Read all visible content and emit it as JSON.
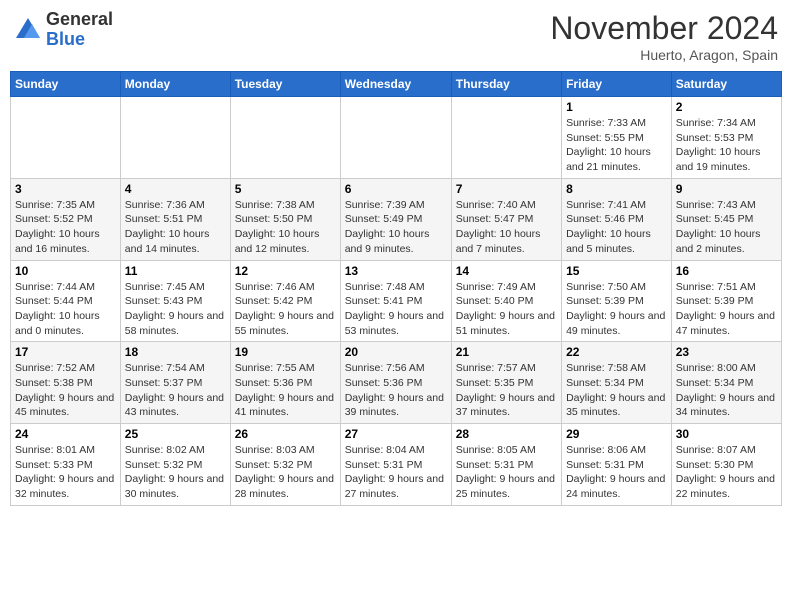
{
  "header": {
    "logo_general": "General",
    "logo_blue": "Blue",
    "month_title": "November 2024",
    "subtitle": "Huerto, Aragon, Spain"
  },
  "days_of_week": [
    "Sunday",
    "Monday",
    "Tuesday",
    "Wednesday",
    "Thursday",
    "Friday",
    "Saturday"
  ],
  "weeks": [
    {
      "days": [
        {
          "num": "",
          "info": ""
        },
        {
          "num": "",
          "info": ""
        },
        {
          "num": "",
          "info": ""
        },
        {
          "num": "",
          "info": ""
        },
        {
          "num": "",
          "info": ""
        },
        {
          "num": "1",
          "info": "Sunrise: 7:33 AM\nSunset: 5:55 PM\nDaylight: 10 hours and 21 minutes."
        },
        {
          "num": "2",
          "info": "Sunrise: 7:34 AM\nSunset: 5:53 PM\nDaylight: 10 hours and 19 minutes."
        }
      ]
    },
    {
      "days": [
        {
          "num": "3",
          "info": "Sunrise: 7:35 AM\nSunset: 5:52 PM\nDaylight: 10 hours and 16 minutes."
        },
        {
          "num": "4",
          "info": "Sunrise: 7:36 AM\nSunset: 5:51 PM\nDaylight: 10 hours and 14 minutes."
        },
        {
          "num": "5",
          "info": "Sunrise: 7:38 AM\nSunset: 5:50 PM\nDaylight: 10 hours and 12 minutes."
        },
        {
          "num": "6",
          "info": "Sunrise: 7:39 AM\nSunset: 5:49 PM\nDaylight: 10 hours and 9 minutes."
        },
        {
          "num": "7",
          "info": "Sunrise: 7:40 AM\nSunset: 5:47 PM\nDaylight: 10 hours and 7 minutes."
        },
        {
          "num": "8",
          "info": "Sunrise: 7:41 AM\nSunset: 5:46 PM\nDaylight: 10 hours and 5 minutes."
        },
        {
          "num": "9",
          "info": "Sunrise: 7:43 AM\nSunset: 5:45 PM\nDaylight: 10 hours and 2 minutes."
        }
      ]
    },
    {
      "days": [
        {
          "num": "10",
          "info": "Sunrise: 7:44 AM\nSunset: 5:44 PM\nDaylight: 10 hours and 0 minutes."
        },
        {
          "num": "11",
          "info": "Sunrise: 7:45 AM\nSunset: 5:43 PM\nDaylight: 9 hours and 58 minutes."
        },
        {
          "num": "12",
          "info": "Sunrise: 7:46 AM\nSunset: 5:42 PM\nDaylight: 9 hours and 55 minutes."
        },
        {
          "num": "13",
          "info": "Sunrise: 7:48 AM\nSunset: 5:41 PM\nDaylight: 9 hours and 53 minutes."
        },
        {
          "num": "14",
          "info": "Sunrise: 7:49 AM\nSunset: 5:40 PM\nDaylight: 9 hours and 51 minutes."
        },
        {
          "num": "15",
          "info": "Sunrise: 7:50 AM\nSunset: 5:39 PM\nDaylight: 9 hours and 49 minutes."
        },
        {
          "num": "16",
          "info": "Sunrise: 7:51 AM\nSunset: 5:39 PM\nDaylight: 9 hours and 47 minutes."
        }
      ]
    },
    {
      "days": [
        {
          "num": "17",
          "info": "Sunrise: 7:52 AM\nSunset: 5:38 PM\nDaylight: 9 hours and 45 minutes."
        },
        {
          "num": "18",
          "info": "Sunrise: 7:54 AM\nSunset: 5:37 PM\nDaylight: 9 hours and 43 minutes."
        },
        {
          "num": "19",
          "info": "Sunrise: 7:55 AM\nSunset: 5:36 PM\nDaylight: 9 hours and 41 minutes."
        },
        {
          "num": "20",
          "info": "Sunrise: 7:56 AM\nSunset: 5:36 PM\nDaylight: 9 hours and 39 minutes."
        },
        {
          "num": "21",
          "info": "Sunrise: 7:57 AM\nSunset: 5:35 PM\nDaylight: 9 hours and 37 minutes."
        },
        {
          "num": "22",
          "info": "Sunrise: 7:58 AM\nSunset: 5:34 PM\nDaylight: 9 hours and 35 minutes."
        },
        {
          "num": "23",
          "info": "Sunrise: 8:00 AM\nSunset: 5:34 PM\nDaylight: 9 hours and 34 minutes."
        }
      ]
    },
    {
      "days": [
        {
          "num": "24",
          "info": "Sunrise: 8:01 AM\nSunset: 5:33 PM\nDaylight: 9 hours and 32 minutes."
        },
        {
          "num": "25",
          "info": "Sunrise: 8:02 AM\nSunset: 5:32 PM\nDaylight: 9 hours and 30 minutes."
        },
        {
          "num": "26",
          "info": "Sunrise: 8:03 AM\nSunset: 5:32 PM\nDaylight: 9 hours and 28 minutes."
        },
        {
          "num": "27",
          "info": "Sunrise: 8:04 AM\nSunset: 5:31 PM\nDaylight: 9 hours and 27 minutes."
        },
        {
          "num": "28",
          "info": "Sunrise: 8:05 AM\nSunset: 5:31 PM\nDaylight: 9 hours and 25 minutes."
        },
        {
          "num": "29",
          "info": "Sunrise: 8:06 AM\nSunset: 5:31 PM\nDaylight: 9 hours and 24 minutes."
        },
        {
          "num": "30",
          "info": "Sunrise: 8:07 AM\nSunset: 5:30 PM\nDaylight: 9 hours and 22 minutes."
        }
      ]
    }
  ]
}
